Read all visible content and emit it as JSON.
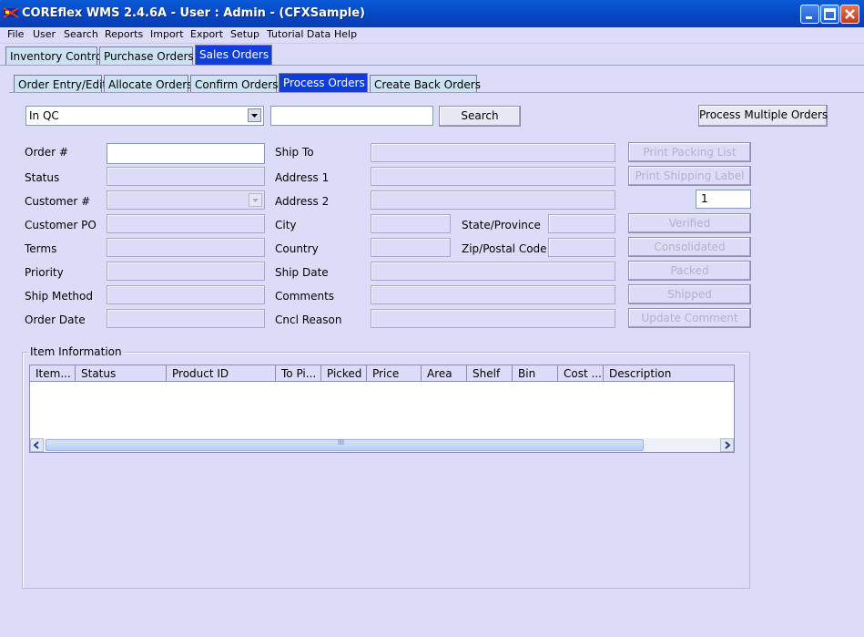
{
  "window": {
    "title": "COREflex WMS 2.4.6A - User : Admin - (CFXSample)"
  },
  "menu": [
    "File",
    "User",
    "Search",
    "Reports",
    "Import",
    "Export",
    "Setup",
    "Tutorial Data",
    "Help"
  ],
  "main_tabs": [
    {
      "label": "Inventory Control",
      "active": false
    },
    {
      "label": "Purchase Orders",
      "active": false
    },
    {
      "label": "Sales Orders",
      "active": true
    }
  ],
  "sub_tabs": [
    {
      "label": "Order Entry/Edit",
      "active": false
    },
    {
      "label": "Allocate Orders",
      "active": false
    },
    {
      "label": "Confirm Orders",
      "active": false
    },
    {
      "label": "Process Orders",
      "active": true
    },
    {
      "label": "Create Back Orders",
      "active": false
    }
  ],
  "search": {
    "filter_value": "In QC",
    "text_value": "",
    "button": "Search"
  },
  "process_multiple_button": "Process Multiple Orders",
  "left_labels": [
    "Order #",
    "Status",
    "Customer #",
    "Customer PO",
    "Terms",
    "Priority",
    "Ship Method",
    "Order Date"
  ],
  "mid_labels": [
    "Ship To",
    "Address 1",
    "Address 2",
    "City",
    "Country",
    "Ship Date",
    "Comments",
    "Cncl Reason"
  ],
  "state_label": "State/Province",
  "zip_label": "Zip/Postal Code",
  "side_buttons": {
    "print_packing_list": "Print Packing List",
    "print_shipping_label": "Print Shipping Label",
    "label_count": "1",
    "verified": "Verified",
    "consolidated": "Consolidated",
    "packed": "Packed",
    "shipped": "Shipped",
    "update_comment": "Update Comment"
  },
  "item_info": {
    "title": "Item Information",
    "columns": [
      "Item...",
      "Status",
      "Product ID",
      "To Pi...",
      "Picked",
      "Price",
      "Area",
      "Shelf",
      "Bin",
      "Cost ...",
      "Description"
    ],
    "scroll_grip": "III"
  }
}
